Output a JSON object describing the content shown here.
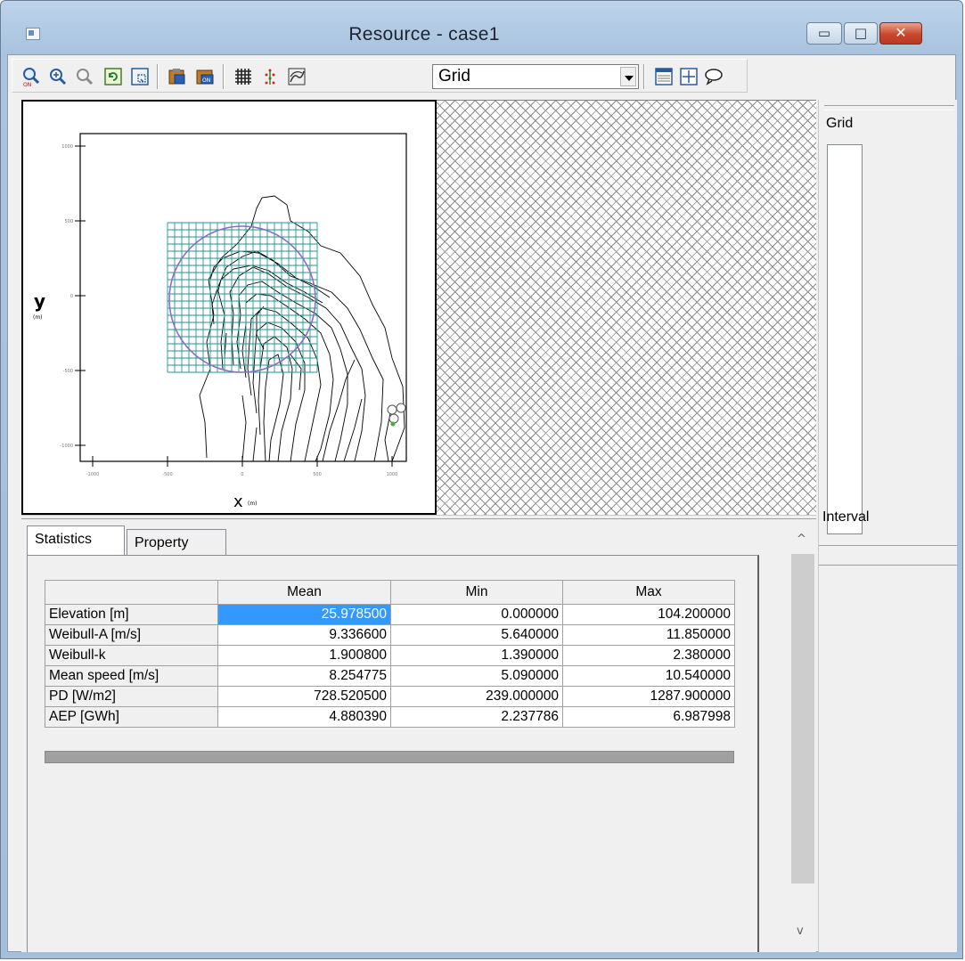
{
  "window": {
    "title": "Resource - case1",
    "minimize_glyph": "▭",
    "maximize_glyph": "□",
    "close_glyph": "✕"
  },
  "toolbar": {
    "icons": [
      "zoom-out-icon",
      "zoom-in-icon",
      "zoom-reset-icon",
      "refresh-icon",
      "fit-view-icon",
      "copy-icon",
      "paste-icon",
      "grid-toggle-icon",
      "turbine-layout-icon",
      "map-icon"
    ],
    "layer_select_value": "Grid",
    "right_icons": [
      "table-view-icon",
      "move-icon",
      "comment-icon"
    ]
  },
  "map": {
    "y_axis_label": "y",
    "y_axis_unit": "(m)",
    "x_axis_label": "x",
    "x_axis_unit": "(m)",
    "y_ticks": [
      "1000",
      "500",
      "0",
      "-500",
      "-1000"
    ],
    "x_ticks": [
      "-1000",
      "-500",
      "0",
      "500",
      "1000"
    ]
  },
  "side_panel": {
    "grid_label": "Grid",
    "interval_label": "Interval"
  },
  "tabs": [
    {
      "label": "Statistics",
      "active": true
    },
    {
      "label": "Property",
      "active": false
    }
  ],
  "statistics": {
    "columns": [
      "",
      "Mean",
      "Min",
      "Max"
    ],
    "rows": [
      {
        "name": "Elevation [m]",
        "mean": "25.978500",
        "min": "0.000000",
        "max": "104.200000"
      },
      {
        "name": "Weibull-A [m/s]",
        "mean": "9.336600",
        "min": "5.640000",
        "max": "11.850000"
      },
      {
        "name": "Weibull-k",
        "mean": "1.900800",
        "min": "1.390000",
        "max": "2.380000"
      },
      {
        "name": "Mean speed [m/s]",
        "mean": "8.254775",
        "min": "5.090000",
        "max": "10.540000"
      },
      {
        "name": "PD [W/m2]",
        "mean": "728.520500",
        "min": "239.000000",
        "max": "1287.900000"
      },
      {
        "name": "AEP [GWh]",
        "mean": "4.880390",
        "min": "2.237786",
        "max": "6.987998"
      }
    ]
  },
  "scrollbar": {
    "up_glyph": "^",
    "down_glyph": "v"
  },
  "colors": {
    "selection": "#3399ff",
    "grid_lines": "#1a9a96",
    "circle": "#8a6fc2",
    "close_button": "#c9462c"
  }
}
